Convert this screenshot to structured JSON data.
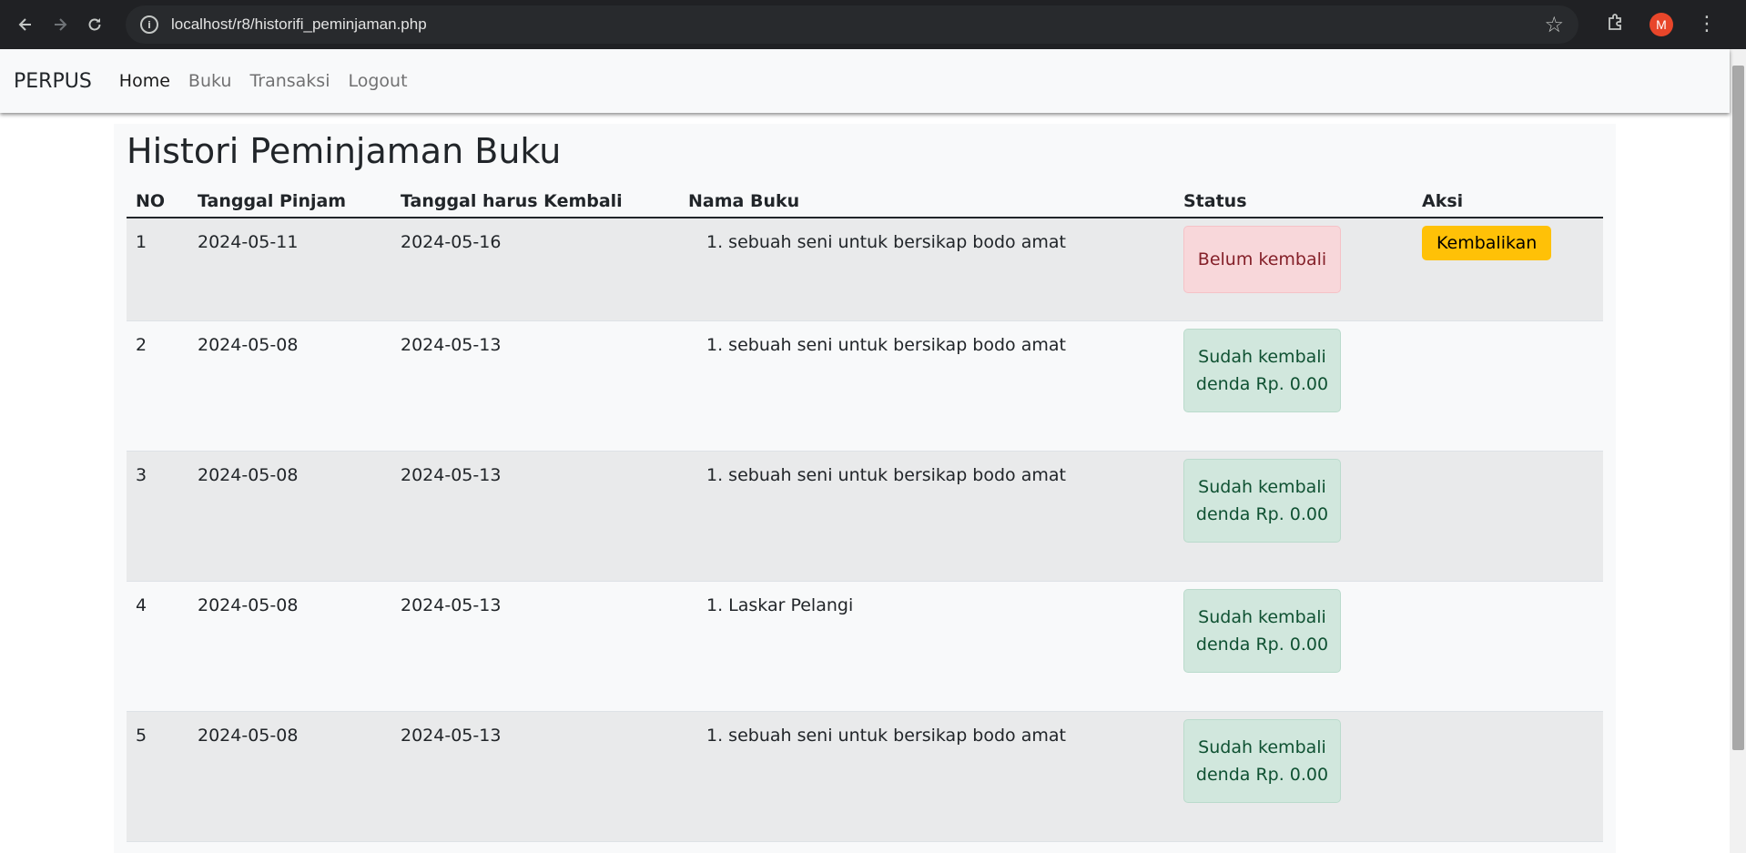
{
  "browser": {
    "url": "localhost/r8/historifi_peminjaman.php",
    "profile_initial": "M"
  },
  "navbar": {
    "brand": "PERPUS",
    "items": [
      "Home",
      "Buku",
      "Transaksi",
      "Logout"
    ]
  },
  "page": {
    "title": "Histori Peminjaman Buku"
  },
  "table": {
    "headers": [
      "NO",
      "Tanggal Pinjam",
      "Tanggal harus Kembali",
      "Nama Buku",
      "Status",
      "Aksi"
    ],
    "rows": [
      {
        "no": "1",
        "tanggal_pinjam": "2024-05-11",
        "tanggal_kembali": "2024-05-16",
        "buku": "1. sebuah seni untuk bersikap bodo amat",
        "status": "Belum kembali",
        "denda": "",
        "aksi": "Kembalikan"
      },
      {
        "no": "2",
        "tanggal_pinjam": "2024-05-08",
        "tanggal_kembali": "2024-05-13",
        "buku": "1. sebuah seni untuk bersikap bodo amat",
        "status": "Sudah kembali",
        "denda": "denda Rp. 0.00",
        "aksi": ""
      },
      {
        "no": "3",
        "tanggal_pinjam": "2024-05-08",
        "tanggal_kembali": "2024-05-13",
        "buku": "1. sebuah seni untuk bersikap bodo amat",
        "status": "Sudah kembali",
        "denda": "denda Rp. 0.00",
        "aksi": ""
      },
      {
        "no": "4",
        "tanggal_pinjam": "2024-05-08",
        "tanggal_kembali": "2024-05-13",
        "buku": "1. Laskar Pelangi",
        "status": "Sudah kembali",
        "denda": "denda Rp. 0.00",
        "aksi": ""
      },
      {
        "no": "5",
        "tanggal_pinjam": "2024-05-08",
        "tanggal_kembali": "2024-05-13",
        "buku": "1. sebuah seni untuk bersikap bodo amat",
        "status": "Sudah kembali",
        "denda": "denda Rp. 0.00",
        "aksi": ""
      }
    ]
  },
  "colors": {
    "danger_bg": "#f8d7da",
    "success_bg": "#d1e7dd",
    "warning": "#ffc107"
  }
}
